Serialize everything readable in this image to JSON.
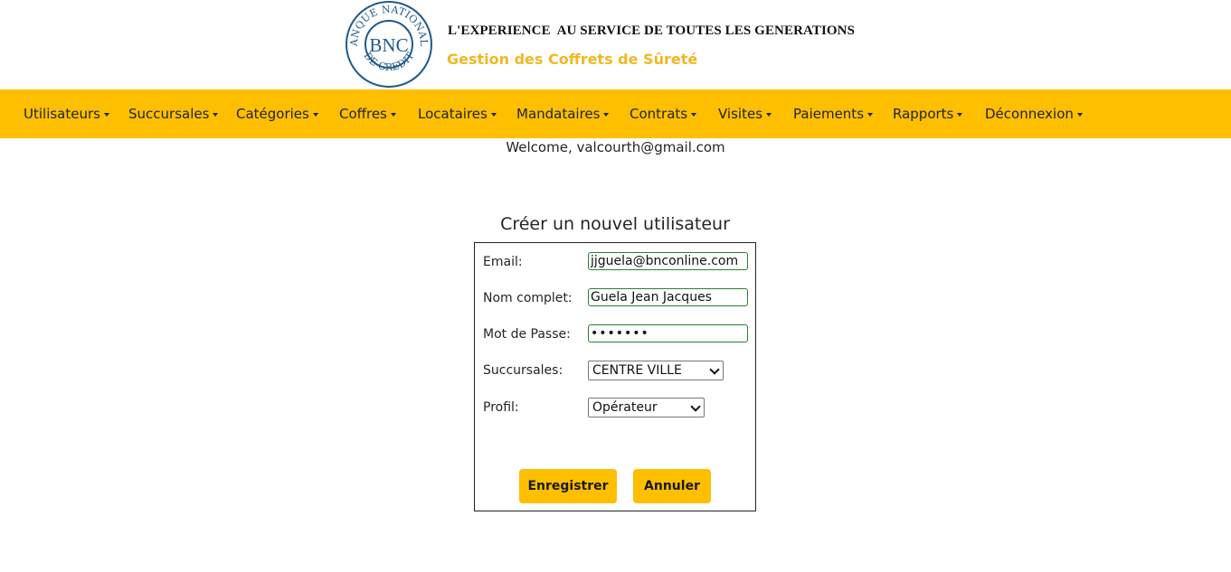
{
  "header": {
    "logo": {
      "top_text": "BANQUE NATIONALE",
      "center_text": "BNC",
      "bottom_text": "DE CREDIT"
    },
    "slogan": "L'EXPERIENCE  AU SERVICE DE TOUTES LES GENERATIONS",
    "subtitle": "Gestion des Coffrets de Sûreté"
  },
  "nav": {
    "items": [
      {
        "label": "Utilisateurs"
      },
      {
        "label": "Succursales"
      },
      {
        "label": "Catégories"
      },
      {
        "label": "Coffres"
      },
      {
        "label": "Locataires"
      },
      {
        "label": "Mandataires"
      },
      {
        "label": "Contrats"
      },
      {
        "label": "Visites"
      },
      {
        "label": "Paiements"
      },
      {
        "label": "Rapports"
      },
      {
        "label": "Déconnexion"
      }
    ]
  },
  "welcome": "Welcome, valcourth@gmail.com",
  "form": {
    "title": "Créer un nouvel utilisateur",
    "email_label": "Email:",
    "email_value": "jjguela@bnconline.com",
    "name_label": "Nom complet:",
    "name_value": "Guela Jean Jacques",
    "password_label": "Mot de Passe:",
    "password_value": "•••••••",
    "branch_label": "Succursales:",
    "branch_value": "CENTRE VILLE",
    "profile_label": "Profil:",
    "profile_value": "Opérateur",
    "save_label": "Enregistrer",
    "cancel_label": "Annuler"
  },
  "colors": {
    "accent": "#fdbf00",
    "subtitle": "#f0b921",
    "logo_blue": "#1e5a8c",
    "input_border": "#2e7d32"
  }
}
